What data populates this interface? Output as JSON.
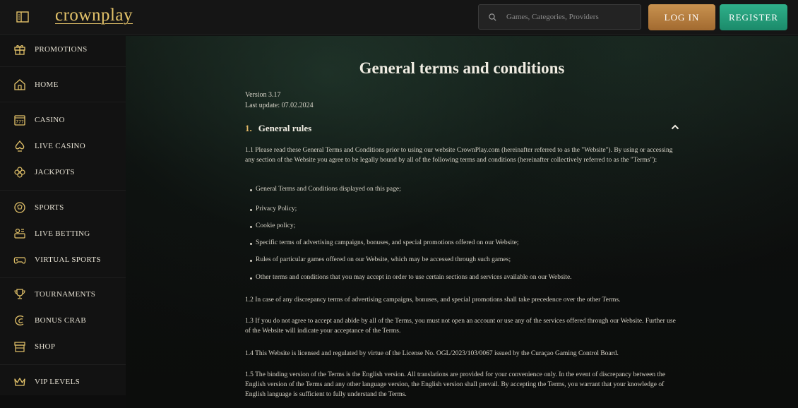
{
  "header": {
    "logo_text": "crownplay",
    "search_placeholder": "Games, Categories, Providers",
    "login_label": "LOG IN",
    "register_label": "REGISTER"
  },
  "sidebar": {
    "items": [
      {
        "label": "PROMOTIONS",
        "icon": "gift-icon"
      },
      {
        "label": "HOME",
        "icon": "home-icon"
      },
      {
        "label": "CASINO",
        "icon": "slot-machine-icon"
      },
      {
        "label": "LIVE CASINO",
        "icon": "spade-icon"
      },
      {
        "label": "JACKPOTS",
        "icon": "clover-icon"
      },
      {
        "label": "SPORTS",
        "icon": "ball-icon"
      },
      {
        "label": "LIVE BETTING",
        "icon": "live-betting-icon"
      },
      {
        "label": "VIRTUAL SPORTS",
        "icon": "gamepad-icon"
      },
      {
        "label": "TOURNAMENTS",
        "icon": "trophy-icon"
      },
      {
        "label": "BONUS CRAB",
        "icon": "bonus-crab-icon"
      },
      {
        "label": "SHOP",
        "icon": "shop-icon"
      },
      {
        "label": "VIP LEVELS",
        "icon": "crown-icon"
      }
    ]
  },
  "main": {
    "title": "General terms and conditions",
    "version": "Version 3.17",
    "last_update": "Last update: 07.02.2024",
    "section": {
      "number": "1.",
      "title": "General rules"
    },
    "p1_1": "1.1 Please read these General Terms and Conditions prior to using our website CrownPlay.com (hereinafter referred to as the \"Website\"). By using or accessing any section of the Website you agree to be legally bound by all of the following terms and conditions (hereinafter collectively referred to as the \"Terms\"):",
    "bullets": [
      "General Terms and Conditions displayed on this page;",
      "Privacy Policy;",
      "Cookie policy;",
      "Specific terms of advertising campaigns, bonuses, and special promotions offered on our Website;",
      "Rules of particular games offered on our Website, which may be accessed through such games;",
      "Other terms and conditions that you may accept in order to use certain sections and services available on our Website."
    ],
    "p1_2": "1.2 In case of any discrepancy terms of advertising campaigns, bonuses, and special promotions shall take precedence over the other Terms.",
    "p1_3": "1.3 If you do not agree to accept and abide by all of the Terms, you must not open an account or use any of the services offered through our Website. Further use of the Website will indicate your acceptance of the Terms.",
    "p1_4": "1.4 This Website is licensed and regulated by virtue of the License No. OGL/2023/103/0067 issued by the Curaçao Gaming Control Board.",
    "p1_5": "1.5 The binding version of the Terms is the English version. All translations are provided for your convenience only. In the event of discrepancy between the English version of the Terms and any other language version, the English version shall prevail. By accepting the Terms, you warrant that your knowledge of English language is sufficient to fully understand the Terms."
  },
  "colors": {
    "accent_gold": "#e2b866",
    "login_bg": "#b57d3e",
    "register_bg": "#24a07c"
  }
}
